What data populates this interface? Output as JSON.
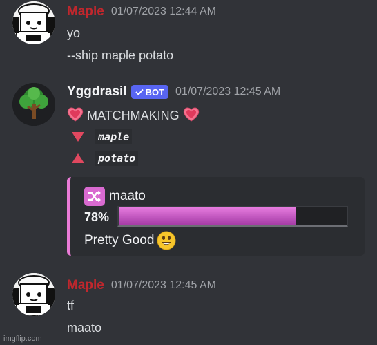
{
  "messages": [
    {
      "author": "Maple",
      "timestamp": "01/07/2023 12:44 AM",
      "lines": [
        "yo",
        "--ship maple potato"
      ]
    },
    {
      "author": "Yggdrasil",
      "bot_tag": "BOT",
      "timestamp": "01/07/2023 12:45 AM",
      "heading": "MATCHMAKING",
      "user_down": "maple",
      "user_up": "potato",
      "embed": {
        "title": "maato",
        "percent_label": "78%",
        "percent": 78,
        "rating": "Pretty Good"
      }
    },
    {
      "author": "Maple",
      "timestamp": "01/07/2023 12:45 AM",
      "lines": [
        "tf",
        "maato"
      ]
    }
  ],
  "watermark": "imgflip.com",
  "colors": {
    "background": "#313338",
    "maple_name": "#c0272d",
    "bot_tag": "#5865f2",
    "embed_accent": "#ea7bd7",
    "bar_fill": "#d96ad0"
  },
  "icons": [
    "bot-check-icon",
    "heart-icon",
    "down-triangle-icon",
    "up-triangle-icon",
    "shuffle-icon",
    "smiley-icon"
  ]
}
